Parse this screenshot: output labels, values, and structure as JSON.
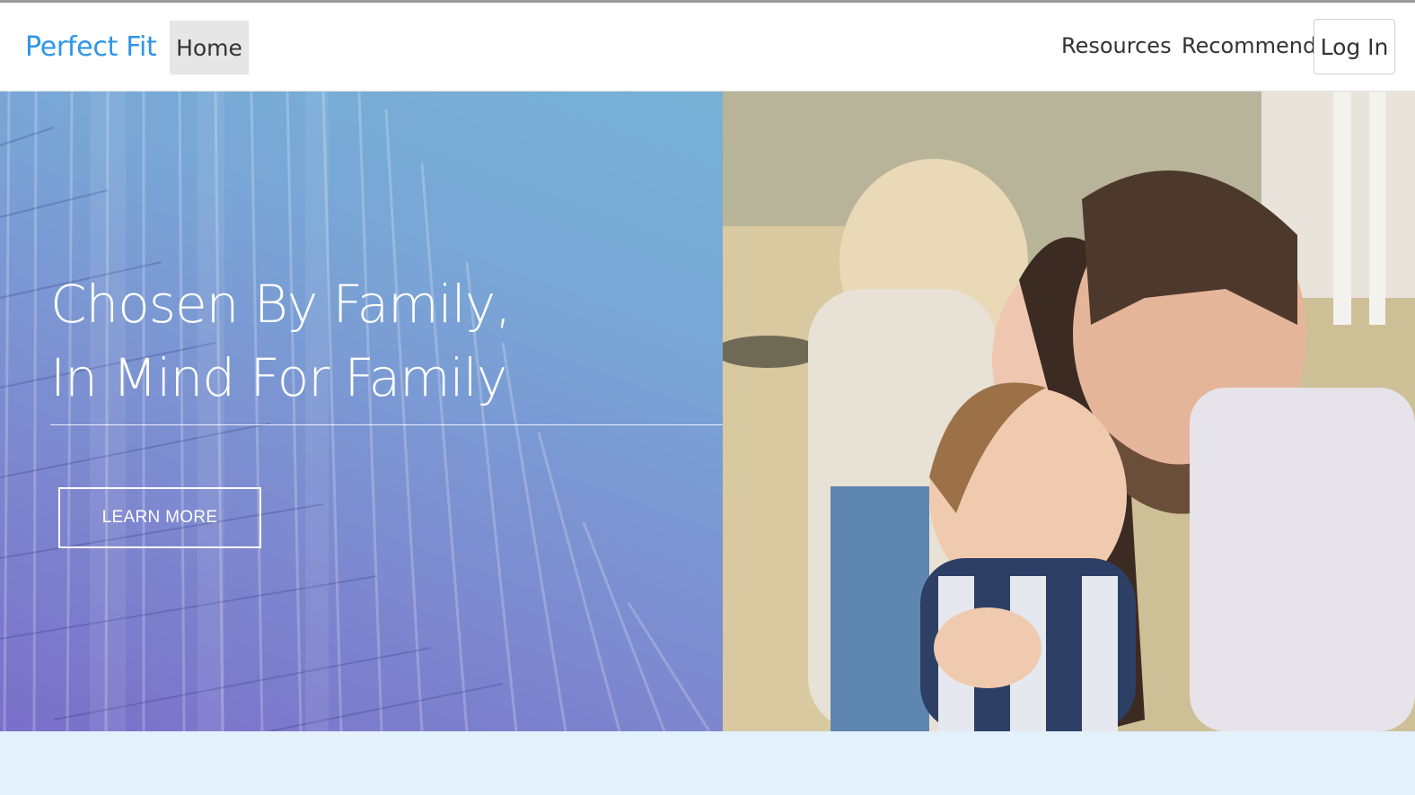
{
  "navbar": {
    "brand": "Perfect Fit",
    "home": "Home",
    "resources": "Resources",
    "recommend": "Recommend",
    "login": "Log In"
  },
  "hero": {
    "headline_line1": "Chosen By Family,",
    "headline_line2": "In Mind For Family",
    "cta": "LEARN MORE"
  },
  "colors": {
    "brand": "#2f95e6",
    "band": "#e3f1fd",
    "gradient_start": "#7b6fc9",
    "gradient_end": "#77b2d6"
  },
  "images": {
    "left": "building-facade-gradient",
    "right": "family-hug-photo"
  }
}
